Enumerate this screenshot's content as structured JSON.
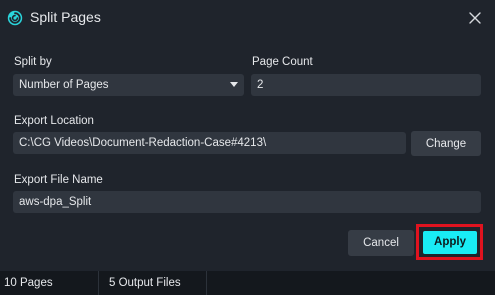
{
  "window": {
    "title": "Split Pages",
    "icon": "split-app-icon",
    "close_icon": "close-icon"
  },
  "form": {
    "split_by": {
      "label": "Split by",
      "selected": "Number of Pages"
    },
    "page_count": {
      "label": "Page Count",
      "value": "2"
    },
    "export_location": {
      "label": "Export Location",
      "value": "C:\\CG Videos\\Document-Redaction-Case#4213\\",
      "change_label": "Change"
    },
    "export_file_name": {
      "label": "Export File Name",
      "value": "aws-dpa_Split"
    }
  },
  "actions": {
    "cancel_label": "Cancel",
    "apply_label": "Apply"
  },
  "status": {
    "pages": "10 Pages",
    "output_files": "5 Output Files"
  },
  "colors": {
    "background": "#1f242c",
    "field": "#30363f",
    "accent": "#19ecf5",
    "highlight": "#e0131f"
  }
}
